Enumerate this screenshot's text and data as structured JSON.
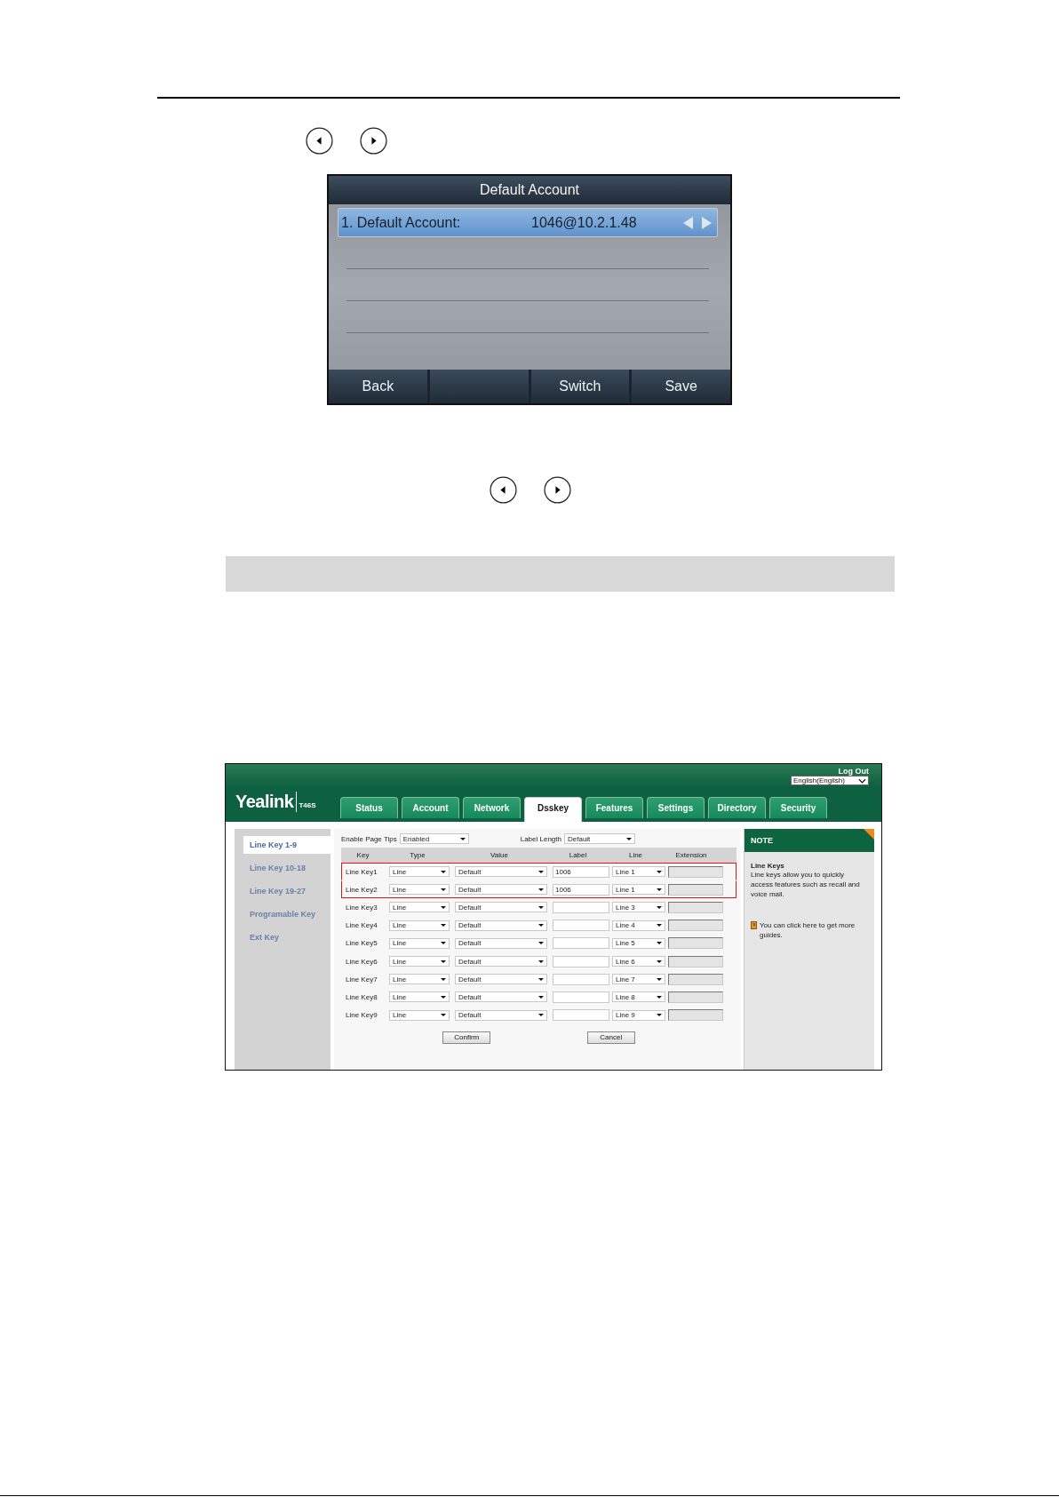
{
  "phone_screen": {
    "title": "Default Account",
    "items": [
      {
        "label": "1. Default Account:",
        "value": "1046@10.2.1.48",
        "selected": true
      }
    ],
    "softkeys": [
      {
        "kind": "label",
        "label": "Back"
      },
      {
        "kind": "blank"
      },
      {
        "kind": "label",
        "label": "Switch"
      },
      {
        "kind": "label",
        "label": "Save"
      }
    ]
  },
  "web_ui": {
    "logo": "Yealink",
    "model": "T46S",
    "logout": "Log Out",
    "language": "English(English)",
    "tabs": [
      {
        "label": "Status",
        "selected": false
      },
      {
        "label": "Account",
        "selected": false
      },
      {
        "label": "Network",
        "selected": false
      },
      {
        "label": "Dsskey",
        "selected": true
      },
      {
        "label": "Features",
        "selected": false
      },
      {
        "label": "Settings",
        "selected": false
      },
      {
        "label": "Directory",
        "selected": false
      },
      {
        "label": "Security",
        "selected": false
      }
    ],
    "sidebar": [
      {
        "label": "Line Key 1-9",
        "selected": true
      },
      {
        "label": "Line Key 10-18",
        "selected": false
      },
      {
        "label": "Line Key 19-27",
        "selected": false
      },
      {
        "label": "Programable Key",
        "selected": false
      },
      {
        "label": "Ext Key",
        "selected": false
      }
    ],
    "page_tips": {
      "label": "Enable Page Tips",
      "value": "Enabled"
    },
    "label_length": {
      "label": "Label Length",
      "value": "Default"
    },
    "columns": [
      "Key",
      "Type",
      "Value",
      "Label",
      "Line",
      "Extension"
    ],
    "rows": [
      {
        "key": "Line Key1",
        "type": "Line",
        "value": "Default",
        "label": "1006",
        "line": "Line 1",
        "highlighted": true
      },
      {
        "key": "Line Key2",
        "type": "Line",
        "value": "Default",
        "label": "1006",
        "line": "Line 1",
        "highlighted": true
      },
      {
        "key": "Line Key3",
        "type": "Line",
        "value": "Default",
        "line": "Line 3",
        "highlighted": false
      },
      {
        "key": "Line Key4",
        "type": "Line",
        "value": "Default",
        "line": "Line 4",
        "highlighted": false
      },
      {
        "key": "Line Key5",
        "type": "Line",
        "value": "Default",
        "line": "Line 5",
        "highlighted": false
      },
      {
        "key": "Line Key6",
        "type": "Line",
        "value": "Default",
        "line": "Line 6",
        "highlighted": false
      },
      {
        "key": "Line Key7",
        "type": "Line",
        "value": "Default",
        "line": "Line 7",
        "highlighted": false
      },
      {
        "key": "Line Key8",
        "type": "Line",
        "value": "Default",
        "line": "Line 8",
        "highlighted": false
      },
      {
        "key": "Line Key9",
        "type": "Line",
        "value": "Default",
        "line": "Line 9",
        "highlighted": false
      }
    ],
    "buttons": [
      "Confirm",
      "Cancel"
    ],
    "note": {
      "title": "NOTE",
      "heading": "Line Keys",
      "text": "Line keys allow you to quickly access features such as recall and voice mail.",
      "guide": "You can click here to get more guides."
    }
  }
}
